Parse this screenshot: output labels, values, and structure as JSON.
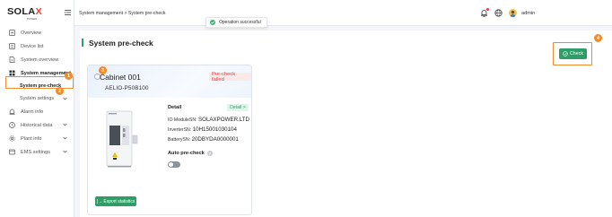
{
  "logo": {
    "brand_main": "SOLA",
    "brand_x": "X",
    "brand_sub": "POWER"
  },
  "colors": {
    "accent": "#2f9e66",
    "annotation": "#f08c2a",
    "failed": "#e23b3b"
  },
  "sidebar": {
    "items": [
      {
        "label": "Overview",
        "icon": "dashboard-icon"
      },
      {
        "label": "Device list",
        "icon": "list-icon"
      },
      {
        "label": "System overview",
        "icon": "document-icon"
      },
      {
        "label": "System management",
        "icon": "grid-icon"
      },
      {
        "label": "Alarm info",
        "icon": "alarm-icon"
      },
      {
        "label": "Historical data",
        "icon": "clock-icon"
      },
      {
        "label": "Plant info",
        "icon": "gear-icon"
      },
      {
        "label": "EMS settings",
        "icon": "ems-icon"
      }
    ],
    "sub_items": [
      {
        "label": "System pre-check",
        "active": true
      },
      {
        "label": "System settings",
        "active": false
      }
    ]
  },
  "annotations": [
    "1",
    "2",
    "3",
    "4"
  ],
  "header": {
    "breadcrumb": "System management > System pre-check",
    "toast": "Operation successful",
    "user": "admin"
  },
  "main": {
    "title": "System pre-check",
    "check_button": "Check",
    "card": {
      "name": "Cabinet 001",
      "sn": "AELIO-P50B100",
      "status_tag": "Pre-check failed",
      "detail_title": "Detail",
      "detail_link": "Detail >",
      "fields": [
        {
          "key": "IO ModuleSN:",
          "value": "SOLAXPOWER.LTD"
        },
        {
          "key": "InverterSN:",
          "value": "10H15001030104"
        },
        {
          "key": "BatterySN:",
          "value": "20DBYDA0000001"
        }
      ],
      "auto_precheck_label": "Auto pre-check",
      "auto_precheck_on": false,
      "export_button": "Export statistics"
    }
  }
}
